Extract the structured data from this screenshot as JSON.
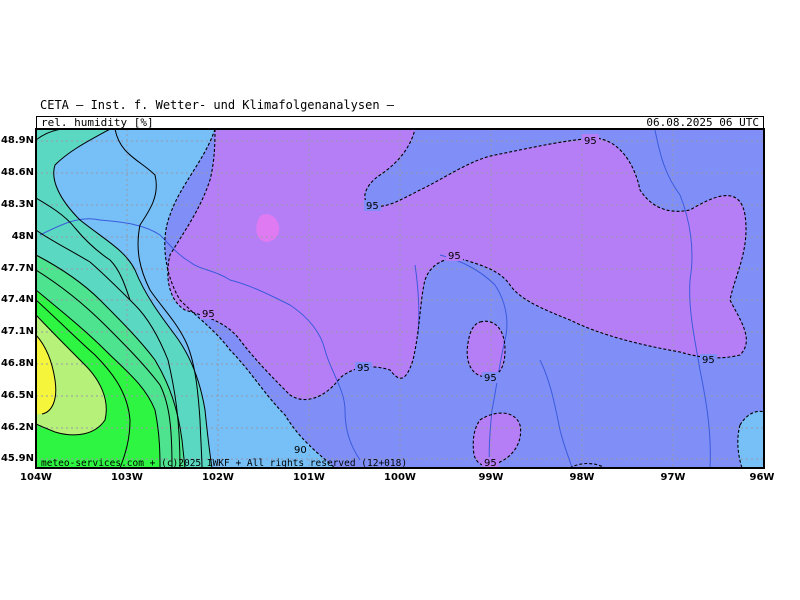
{
  "header": {
    "title": "CETA – Inst. f. Wetter- und Klimafolgenanalysen –",
    "variable": "rel. humidity [%]",
    "datetime": "06.08.2025 06 UTC"
  },
  "footer": {
    "copyright": "meteo-services.com + (c)2025 IWKF + All rights reserved (12+018)"
  },
  "map": {
    "lat_ticks": [
      "48.9N",
      "48.6N",
      "48.3N",
      "48N",
      "47.7N",
      "47.4N",
      "47.1N",
      "46.8N",
      "46.5N",
      "46.2N",
      "45.9N"
    ],
    "lon_ticks": [
      "104W",
      "103W",
      "102W",
      "101W",
      "100W",
      "99W",
      "98W",
      "97W",
      "96W"
    ],
    "contour_labels": [
      "95",
      "95",
      "95",
      "95",
      "95",
      "95",
      "95",
      "95",
      "90",
      "95"
    ],
    "colors": {
      "humid_95_100": "#b67ef6",
      "humid_max": "#e07af2",
      "humid_90_95": "#7f8ff7",
      "humid_85_90": "#76bff7",
      "humid_80_85": "#5bd8c2",
      "humid_75_80": "#4ee38f",
      "humid_70_75": "#2ef541",
      "humid_65_70": "#b6f27a",
      "humid_low": "#f5f53c"
    }
  }
}
